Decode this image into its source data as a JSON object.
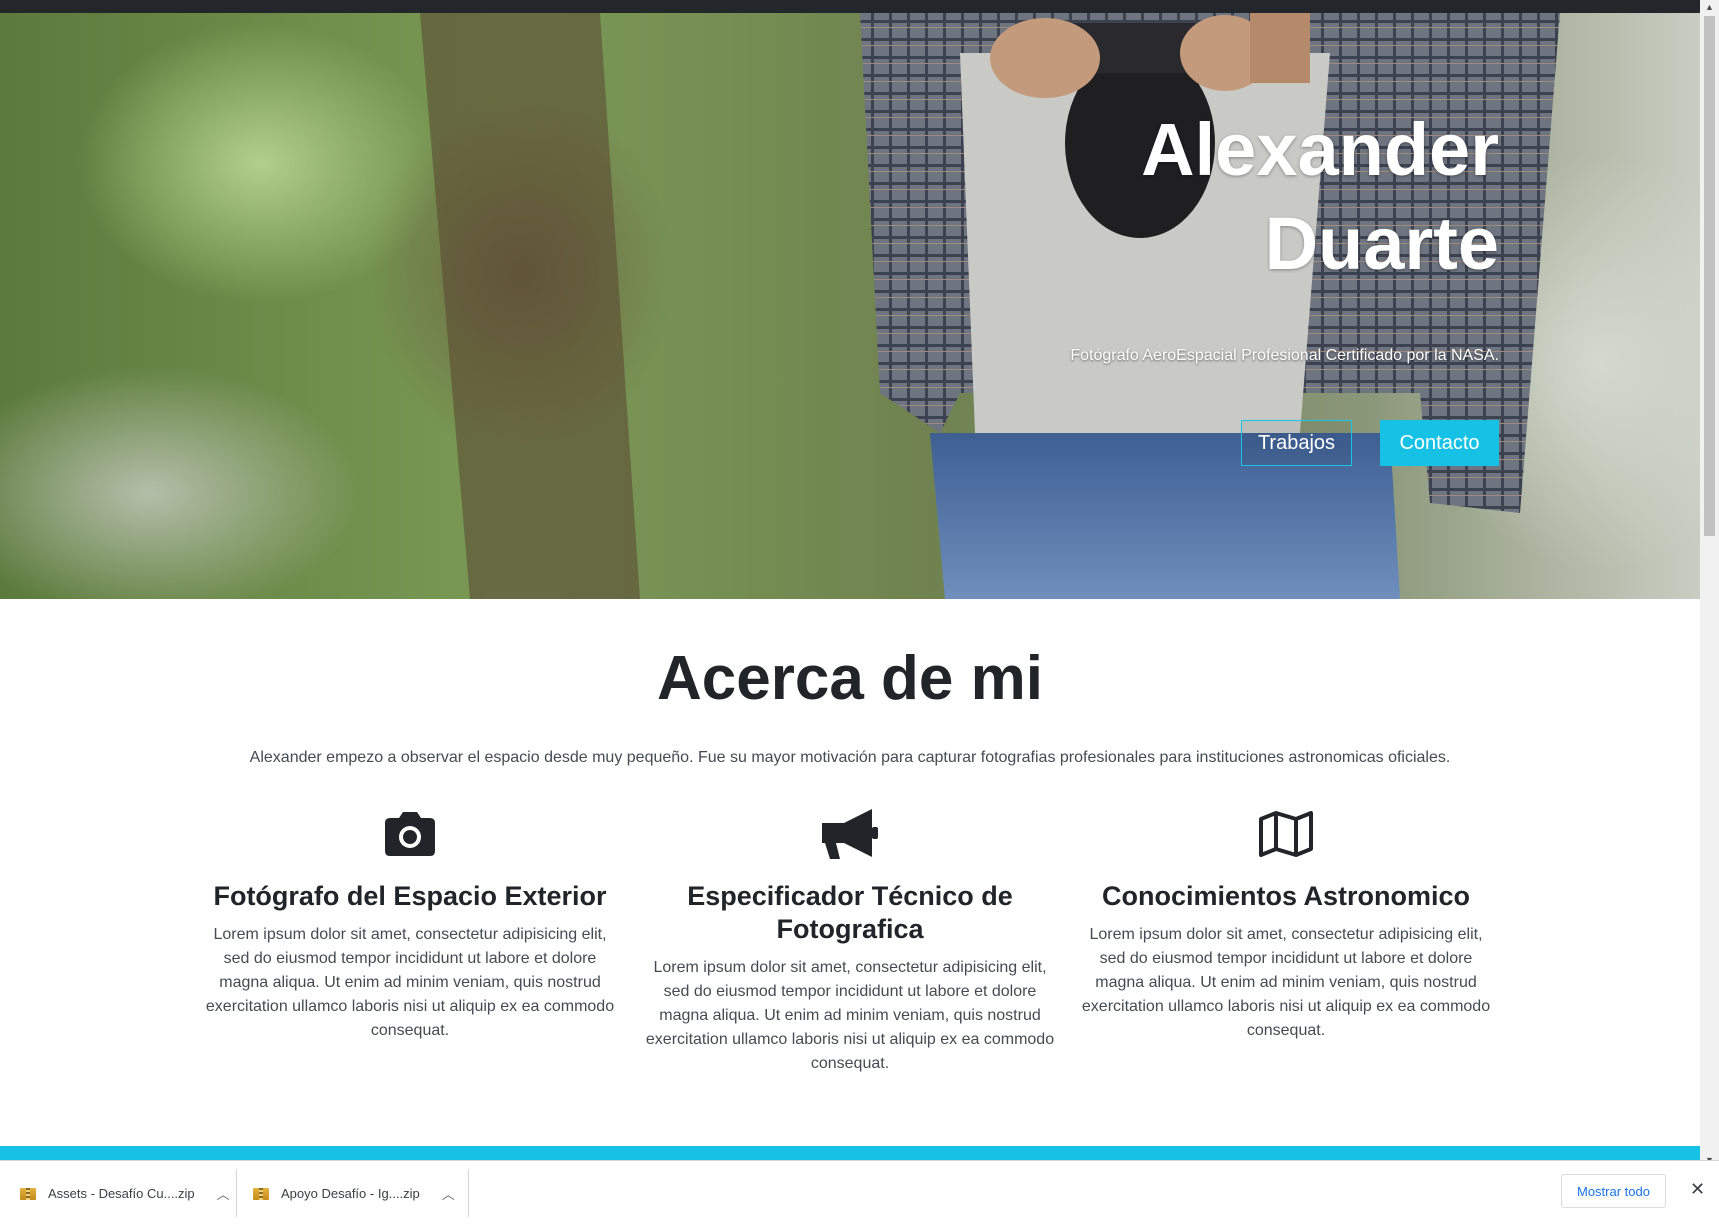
{
  "hero": {
    "title_line1": "Alexander",
    "title_line2": "Duarte",
    "subtitle": "Fotógrafo AeroEspacial Profesional Certificado por la NASA.",
    "button_trabajos": "Trabajos",
    "button_contacto": "Contacto"
  },
  "about": {
    "title": "Acerca de mi",
    "text": "Alexander empezo a observar el espacio desde muy pequeño. Fue su mayor motivación para capturar fotografias profesionales para instituciones astronomicas oficiales.",
    "features": [
      {
        "icon": "camera-icon",
        "title": "Fotógrafo del Espacio Exterior",
        "text": "Lorem ipsum dolor sit amet, consectetur adipisicing elit, sed do eiusmod tempor incididunt ut labore et dolore magna aliqua. Ut enim ad minim veniam, quis nostrud exercitation ullamco laboris nisi ut aliquip ex ea commodo consequat."
      },
      {
        "icon": "megaphone-icon",
        "title": "Especificador Técnico de Fotografica",
        "text": "Lorem ipsum dolor sit amet, consectetur adipisicing elit, sed do eiusmod tempor incididunt ut labore et dolore magna aliqua. Ut enim ad minim veniam, quis nostrud exercitation ullamco laboris nisi ut aliquip ex ea commodo consequat."
      },
      {
        "icon": "map-icon",
        "title": "Conocimientos Astronomico",
        "text": "Lorem ipsum dolor sit amet, consectetur adipisicing elit, sed do eiusmod tempor incididunt ut labore et dolore magna aliqua. Ut enim ad minim veniam, quis nostrud exercitation ullamco laboris nisi ut aliquip ex ea commodo consequat."
      }
    ]
  },
  "downloads": {
    "items": [
      {
        "name": "Assets - Desafío Cu....zip",
        "icon": "zip-file-icon"
      },
      {
        "name": "Apoyo Desafío - Ig....zip",
        "icon": "zip-file-icon"
      }
    ],
    "show_all": "Mostrar todo"
  },
  "colors": {
    "accent": "#15c2e6",
    "topbar": "#23272b",
    "heading": "#212529"
  }
}
